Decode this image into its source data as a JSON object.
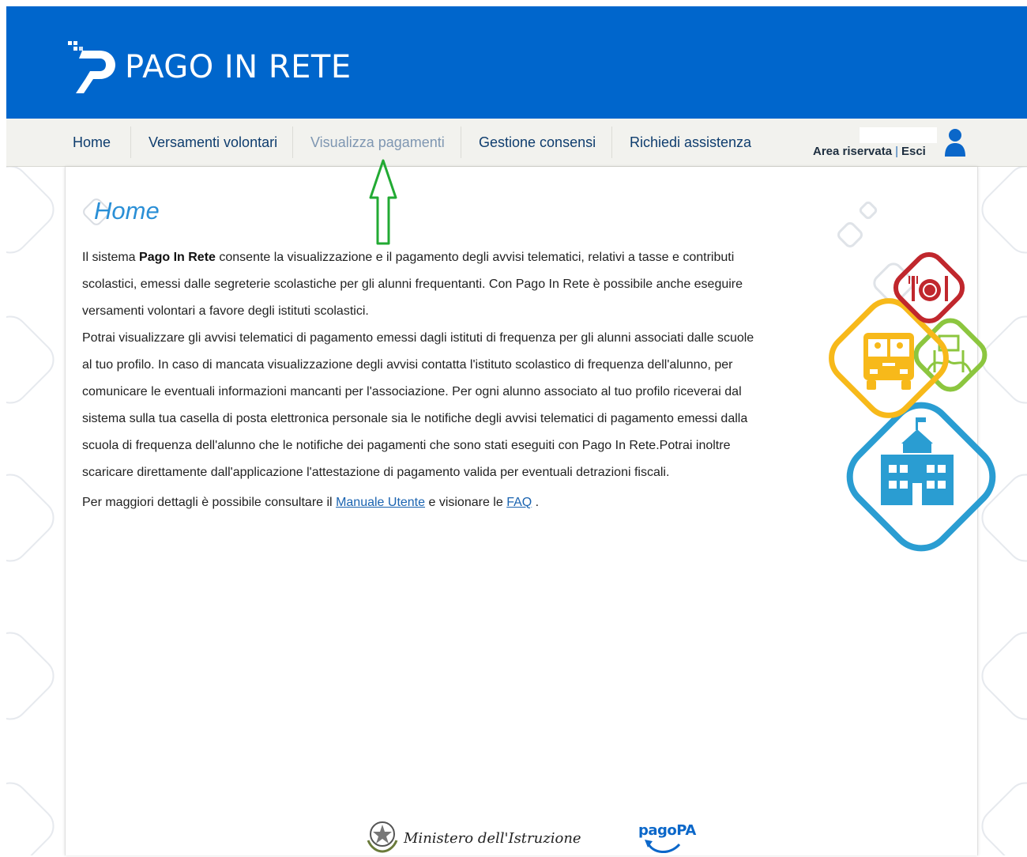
{
  "header": {
    "title": "PAGO IN RETE"
  },
  "nav": {
    "items": [
      {
        "label": "Home"
      },
      {
        "label": "Versamenti volontari"
      },
      {
        "label": "Visualizza pagamenti"
      },
      {
        "label": "Gestione consensi"
      },
      {
        "label": "Richiedi assistenza"
      }
    ],
    "active_index": 2,
    "area_label": "Area riservata",
    "separator": "|",
    "logout_label": "Esci"
  },
  "main": {
    "title": "Home",
    "p1_pre": "Il sistema ",
    "p1_bold": "Pago In Rete",
    "p1_rest": " consente la visualizzazione e il pagamento degli avvisi telematici, relativi a tasse e contributi scolastici, emessi dalle segreterie scolastiche per gli alunni frequentanti. Con Pago In Rete è possibile anche eseguire versamenti volontari a favore degli istituti scolastici.",
    "p2": "Potrai visualizzare gli avvisi telematici di pagamento emessi dagli istituti di frequenza per gli alunni associati dalle scuole al tuo profilo. In caso di mancata visualizzazione degli avvisi contatta l'istituto scolastico di frequenza dell'alunno, per comunicare le eventuali informazioni mancanti per l'associazione. Per ogni alunno associato al tuo profilo riceverai dal sistema sulla tua casella di posta elettronica personale sia le notifiche degli avvisi telematici di pagamento emessi dalla scuola di frequenza dell'alunno che le notifiche dei pagamenti che sono stati eseguiti con Pago In Rete.Potrai inoltre scaricare direttamente dall'applicazione l'attestazione di pagamento valida per eventuali detrazioni fiscali.",
    "p3_pre": "Per maggiori dettagli è possibile consultare il ",
    "manual_link": "Manuale Utente",
    "p3_mid": " e visionare le ",
    "faq_link": "FAQ",
    "p3_end": " ."
  },
  "footer": {
    "ministry": "Ministero dell'Istruzione",
    "pagopa": "pagoPA"
  },
  "colors": {
    "header_bg": "#0066cc",
    "nav_bg": "#f2f2ee",
    "title": "#2a8fd6",
    "arrow": "#22aa33"
  }
}
